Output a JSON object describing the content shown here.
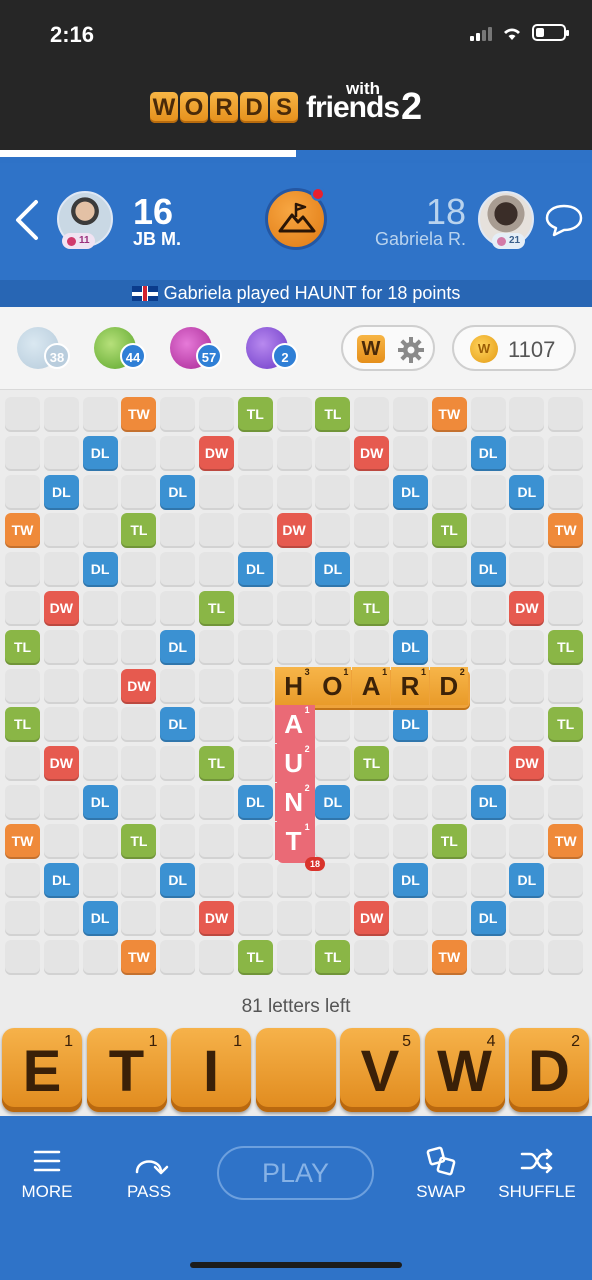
{
  "status": {
    "time": "2:16"
  },
  "logo": {
    "letters": [
      "W",
      "O",
      "R",
      "D",
      "S"
    ],
    "with": "with",
    "friends": "friends",
    "version": "2"
  },
  "game_progress_fraction": 0.5,
  "players": {
    "left": {
      "score": "16",
      "name": "JB M.",
      "level": "11"
    },
    "right": {
      "score": "18",
      "name": "Gabriela R.",
      "level": "21"
    }
  },
  "last_play": "Gabriela played HAUNT for 18 points",
  "powerups": [
    {
      "name": "hindsight",
      "count": "38"
    },
    {
      "name": "word-radar",
      "count": "44"
    },
    {
      "name": "swap-plus",
      "count": "57"
    },
    {
      "name": "word-search",
      "count": "2"
    }
  ],
  "coins": "1107",
  "wordbar_tile": "W",
  "board": {
    "bonus_grid": [
      [
        "",
        "",
        "",
        "TW",
        "",
        "",
        "TL",
        "",
        "TL",
        "",
        "",
        "TW",
        "",
        "",
        ""
      ],
      [
        "",
        "",
        "DL",
        "",
        "",
        "DW",
        "",
        "",
        "",
        "DW",
        "",
        "",
        "DL",
        "",
        ""
      ],
      [
        "",
        "DL",
        "",
        "",
        "DL",
        "",
        "",
        "",
        "",
        "",
        "DL",
        "",
        "",
        "DL",
        ""
      ],
      [
        "TW",
        "",
        "",
        "TL",
        "",
        "",
        "",
        "DW",
        "",
        "",
        "",
        "TL",
        "",
        "",
        "TW"
      ],
      [
        "",
        "",
        "DL",
        "",
        "",
        "",
        "DL",
        "",
        "DL",
        "",
        "",
        "",
        "DL",
        "",
        ""
      ],
      [
        "",
        "DW",
        "",
        "",
        "",
        "TL",
        "",
        "",
        "",
        "TL",
        "",
        "",
        "",
        "DW",
        ""
      ],
      [
        "TL",
        "",
        "",
        "",
        "DL",
        "",
        "",
        "",
        "",
        "",
        "DL",
        "",
        "",
        "",
        "TL"
      ],
      [
        "",
        "",
        "",
        "DW",
        "",
        "",
        "",
        "",
        "",
        "",
        "",
        "",
        "",
        "",
        ""
      ],
      [
        "TL",
        "",
        "",
        "",
        "DL",
        "",
        "",
        "",
        "",
        "",
        "DL",
        "",
        "",
        "",
        "TL"
      ],
      [
        "",
        "DW",
        "",
        "",
        "",
        "TL",
        "",
        "",
        "",
        "TL",
        "",
        "",
        "",
        "DW",
        ""
      ],
      [
        "",
        "",
        "DL",
        "",
        "",
        "",
        "DL",
        "",
        "DL",
        "",
        "",
        "",
        "DL",
        "",
        ""
      ],
      [
        "TW",
        "",
        "",
        "TL",
        "",
        "",
        "",
        "",
        "",
        "",
        "",
        "TL",
        "",
        "",
        "TW"
      ],
      [
        "",
        "DL",
        "",
        "",
        "DL",
        "",
        "",
        "",
        "",
        "",
        "DL",
        "",
        "",
        "DL",
        ""
      ],
      [
        "",
        "",
        "DL",
        "",
        "",
        "DW",
        "",
        "",
        "",
        "DW",
        "",
        "",
        "DL",
        "",
        ""
      ],
      [
        "",
        "",
        "",
        "TW",
        "",
        "",
        "TL",
        "",
        "TL",
        "",
        "",
        "TW",
        "",
        "",
        ""
      ]
    ],
    "words": [
      {
        "word": "HOARD",
        "direction": "across",
        "row": 7,
        "col": 7,
        "points": [
          "3",
          "1",
          "1",
          "1",
          "2"
        ],
        "recent": false
      },
      {
        "word": "HAUNT",
        "direction": "down",
        "row": 7,
        "col": 7,
        "points": [
          "3",
          "1",
          "2",
          "2",
          "1"
        ],
        "recent": true
      }
    ],
    "last_move_score": "18"
  },
  "letters_left": "81 letters left",
  "rack": [
    {
      "letter": "E",
      "points": "1"
    },
    {
      "letter": "T",
      "points": "1"
    },
    {
      "letter": "I",
      "points": "1"
    },
    {
      "letter": "",
      "points": ""
    },
    {
      "letter": "V",
      "points": "5"
    },
    {
      "letter": "W",
      "points": "4"
    },
    {
      "letter": "D",
      "points": "2"
    }
  ],
  "toolbar": {
    "more": "MORE",
    "pass": "PASS",
    "play": "PLAY",
    "swap": "SWAP",
    "shuffle": "SHUFFLE"
  }
}
